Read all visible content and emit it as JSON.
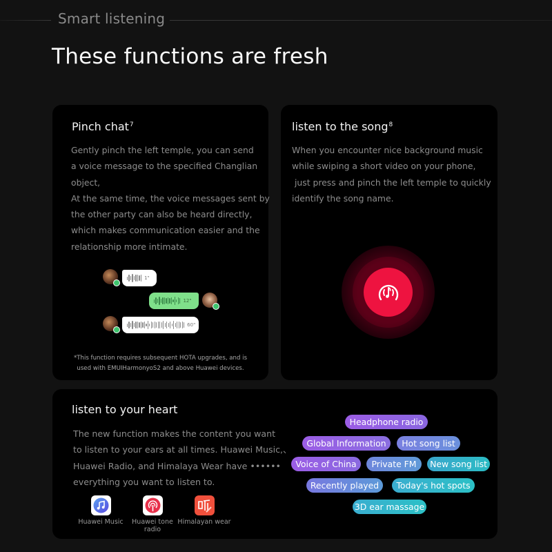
{
  "section": {
    "label": "Smart listening"
  },
  "page_title": "These functions are fresh",
  "cards": {
    "pinch_chat": {
      "title": "Pinch chat",
      "footnote_marker": "7",
      "body_lines": [
        "Gently pinch the left temple, you can send",
        "a voice message to the specified Changlian",
        "object,",
        "At the same time, the voice messages sent by",
        "the other party can also be heard directly,",
        "which makes communication easier and the",
        "relationship more intimate."
      ],
      "chat_messages": [
        {
          "sender": "other",
          "duration": "1\"",
          "color": "white"
        },
        {
          "sender": "self",
          "duration": "12\"",
          "color": "green"
        },
        {
          "sender": "other",
          "duration": "60\"",
          "color": "white"
        }
      ],
      "footnote_lines": [
        "*This function requires subsequent HOTA upgrades, and is",
        "used with EMUIHarmonyoS2 and above Huawei devices."
      ]
    },
    "listen_song": {
      "title": "listen to the song",
      "footnote_marker": "8",
      "body_lines": [
        "When you encounter nice background music",
        "while swiping a short video on your phone,",
        " just press and pinch the left temple to quickly",
        "identify the song name."
      ],
      "icon": "music-recognition-icon",
      "accent_color": "#ee1340"
    },
    "listen_heart": {
      "title": "listen to your heart",
      "body_lines": [
        "The new function makes the content you want",
        "to listen to your ears at all times. Huawei Music,、",
        "Huawei Radio, and Himalaya Wear have ••••••",
        "everything you want to listen to."
      ],
      "apps": [
        {
          "label": "Huawei Music",
          "icon": "huawei-music-icon"
        },
        {
          "label": "Huawei tone radio",
          "icon": "huawei-radio-icon"
        },
        {
          "label": "Himalayan wear",
          "icon": "himalaya-icon"
        }
      ],
      "tags": [
        {
          "label": "Headphone radio",
          "color_from": "#9b5de5",
          "color_to": "#8a66e0"
        },
        {
          "label": "Global Information",
          "color_from": "#9b5de5",
          "color_to": "#8a6ee0"
        },
        {
          "label": "Hot song list",
          "color_from": "#7a80e0",
          "color_to": "#6a90dc"
        },
        {
          "label": "Voice of China",
          "color_from": "#9b5de5",
          "color_to": "#8a6ae0"
        },
        {
          "label": "Private FM",
          "color_from": "#6f86dc",
          "color_to": "#5f9ad8"
        },
        {
          "label": "New song list",
          "color_from": "#3aa6cc",
          "color_to": "#2bbcc4"
        },
        {
          "label": "Recently played",
          "color_from": "#7878e0",
          "color_to": "#5c9ad8"
        },
        {
          "label": "Today's hot spots",
          "color_from": "#3aaed0",
          "color_to": "#2cc0c6"
        },
        {
          "label": "3D ear massage",
          "color_from": "#3aaed0",
          "color_to": "#2cc0c6"
        }
      ]
    }
  }
}
